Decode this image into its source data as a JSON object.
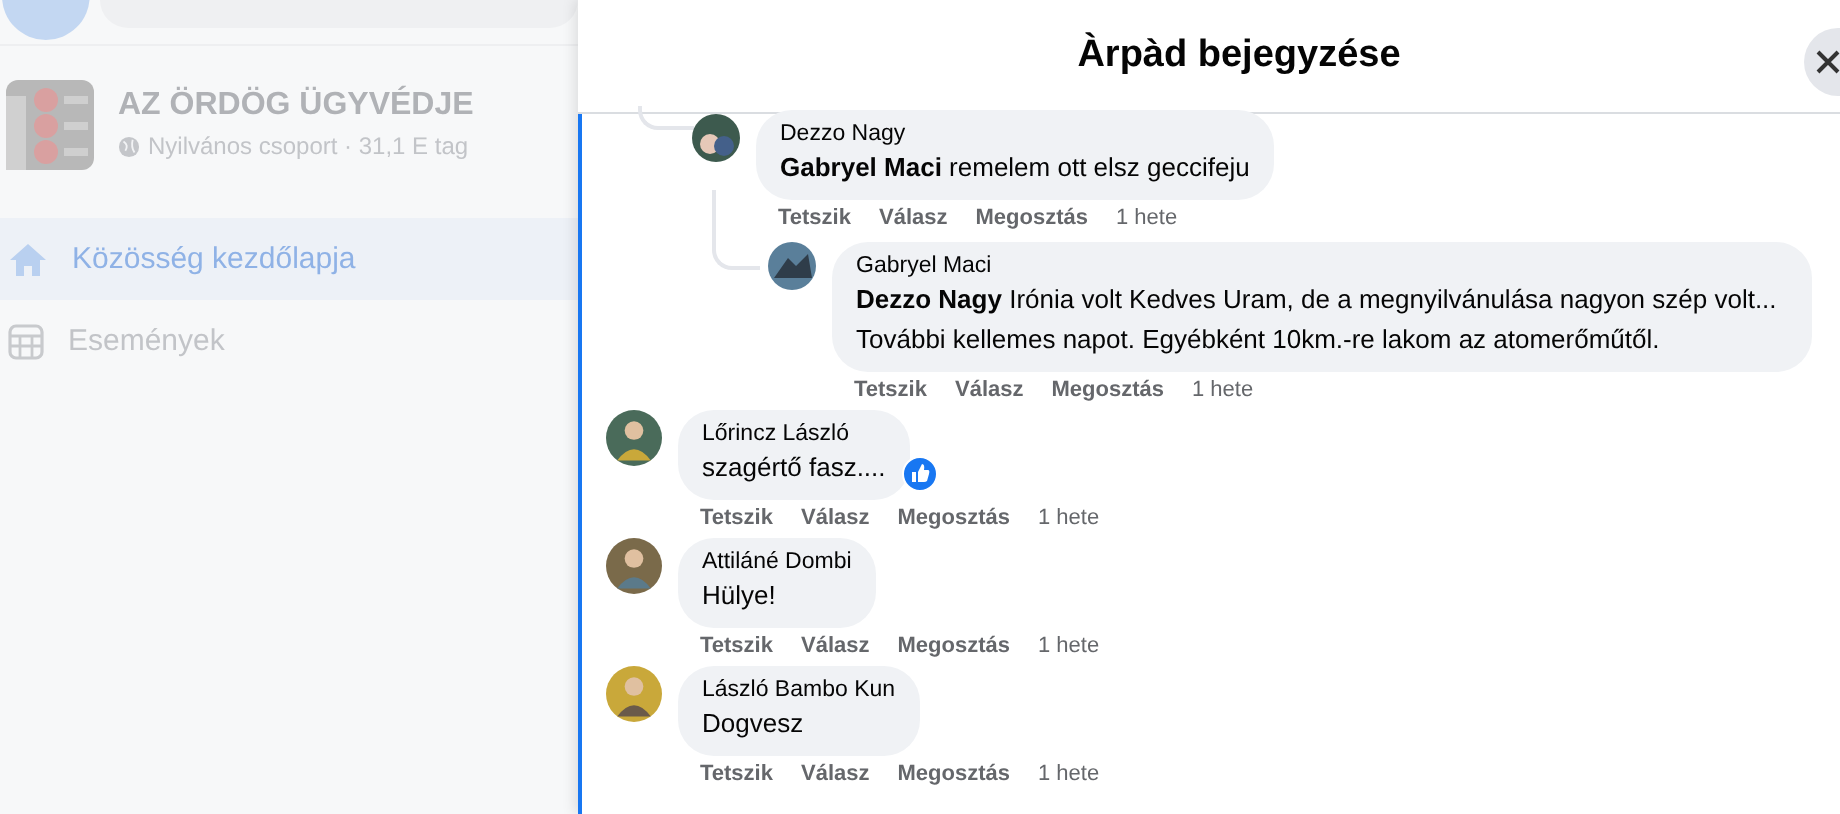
{
  "sidebar": {
    "group": {
      "name": "AZ ÖRDÖG ÜGYVÉDJE",
      "meta": "Nyilvános csoport · 31,1 E tag"
    },
    "items": [
      {
        "label": "Közösség kezdőlapja",
        "kind": "home",
        "selected": true
      },
      {
        "label": "Események",
        "kind": "calendar",
        "selected": false
      }
    ]
  },
  "dialog": {
    "title": "Àrpàd bejegyzése",
    "thread_replies": [
      {
        "author": "Dezzo Nagy",
        "text": "**Gabryel Maci** remelem ott elsz geccifeju",
        "actions": [
          "Tetszik",
          "Válasz",
          "Megosztás"
        ],
        "time": "1 hete",
        "liked": false,
        "children": [
          {
            "author": "Gabryel Maci",
            "text": "**Dezzo Nagy** Irónia volt Kedves Uram, de a megnyilvánulása nagyon szép volt... További kellemes napot. Egyébként 10km.-re lakom az atomerőműtől.",
            "actions": [
              "Tetszik",
              "Válasz",
              "Megosztás"
            ],
            "time": "1 hete",
            "liked": false
          }
        ]
      }
    ],
    "comments": [
      {
        "author": "Lőrincz László",
        "text": "szagértő fasz....",
        "actions": [
          "Tetszik",
          "Válasz",
          "Megosztás"
        ],
        "time": "1 hete",
        "liked": true
      },
      {
        "author": "Attiláné Dombi",
        "text": "Hülye!",
        "actions": [
          "Tetszik",
          "Válasz",
          "Megosztás"
        ],
        "time": "1 hete",
        "liked": false
      },
      {
        "author": "László Bambo Kun",
        "text": "Dogvesz",
        "actions": [
          "Tetszik",
          "Válasz",
          "Megosztás"
        ],
        "time": "1 hete",
        "liked": false
      }
    ]
  }
}
